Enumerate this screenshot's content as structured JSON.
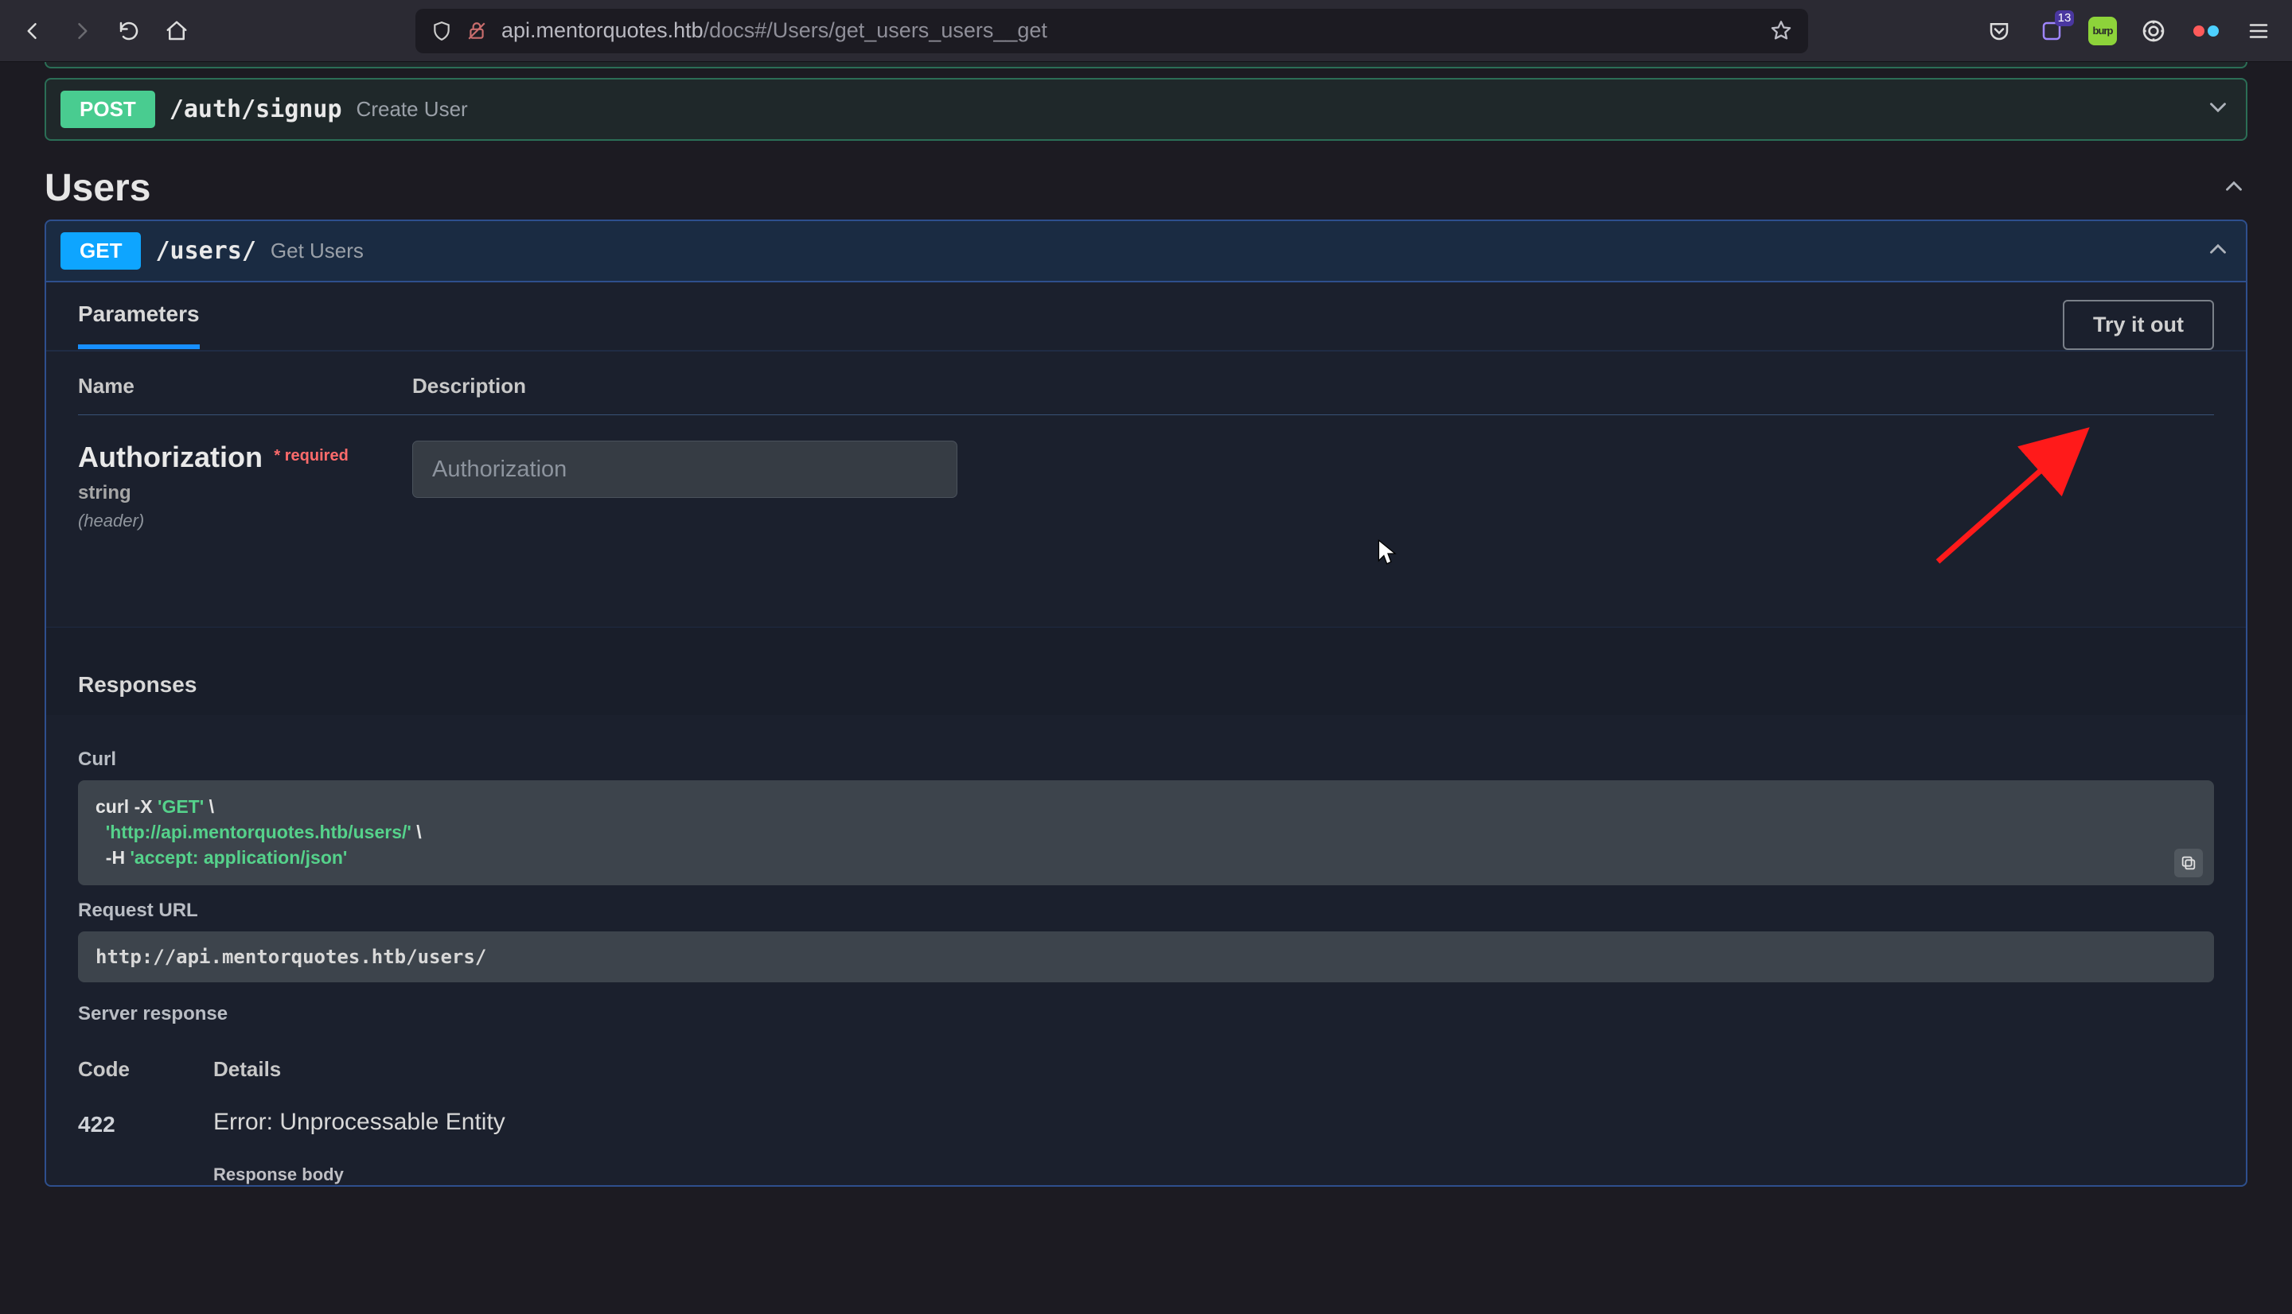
{
  "browser": {
    "url_domain": "api.mentorquotes.htb",
    "url_path": "/docs#/Users/get_users_users__get",
    "notif_badge": "13",
    "burp_text": "burp"
  },
  "ops": {
    "signup": {
      "method": "POST",
      "path": "/auth/signup",
      "summary": "Create User"
    },
    "users": {
      "method": "GET",
      "path": "/users/",
      "summary": "Get Users"
    }
  },
  "section_title": "Users",
  "tabs": {
    "params": "Parameters"
  },
  "try_button": "Try it out",
  "param_headers": {
    "name": "Name",
    "desc": "Description"
  },
  "param": {
    "name": "Authorization",
    "required": "required",
    "type": "string",
    "in": "(header)",
    "placeholder": "Authorization"
  },
  "responses_title": "Responses",
  "curl": {
    "title": "Curl",
    "line1a": "curl -X ",
    "line1b": "'GET'",
    "line1c": " \\",
    "line2a": "  ",
    "line2b": "'http://api.mentorquotes.htb/users/'",
    "line2c": " \\",
    "line3a": "  -H ",
    "line3b": "'accept: application/json'"
  },
  "requrl": {
    "title": "Request URL",
    "value": "http://api.mentorquotes.htb/users/"
  },
  "server_response_title": "Server response",
  "resp_headers": {
    "code": "Code",
    "details": "Details"
  },
  "resp": {
    "code": "422",
    "message": "Error: Unprocessable Entity",
    "body_label": "Response body"
  }
}
